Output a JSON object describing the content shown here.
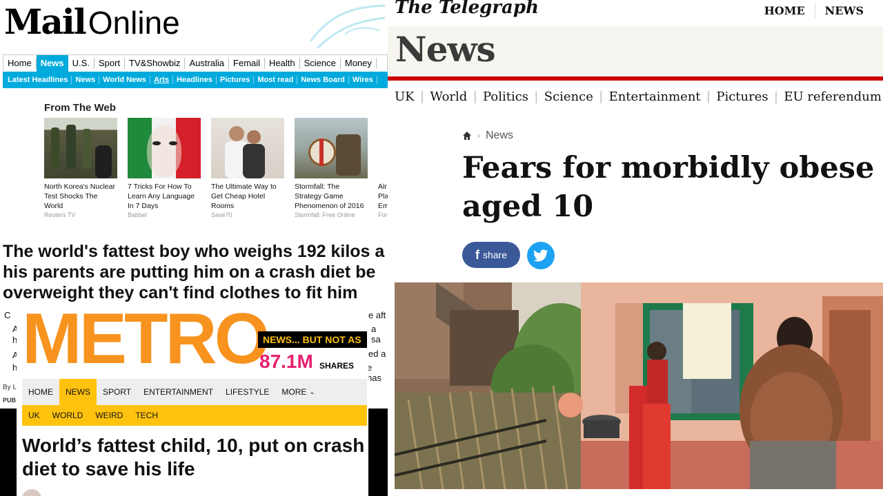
{
  "mail": {
    "logo_bold": "Mail",
    "logo_light": "Online",
    "nav": [
      "Home",
      "News",
      "U.S.",
      "Sport",
      "TV&Showbiz",
      "Australia",
      "Femail",
      "Health",
      "Science",
      "Money"
    ],
    "subnav": [
      "Latest Headlines",
      "News",
      "World News",
      "Arts",
      "Headlines",
      "Pictures",
      "Most read",
      "News Board",
      "Wires"
    ],
    "from_the_web": "From The Web",
    "cards": [
      {
        "title": "North Korea's Nuclear Test Shocks The World",
        "source": "Reuters TV"
      },
      {
        "title": "7 Tricks For How To Learn Any Language In 7 Days",
        "source": "Babbel"
      },
      {
        "title": "The Ultimate Way to Get Cheap Hotel Rooms",
        "source": "Save70"
      },
      {
        "title": "Stormfall: The Strategy Game Phenomenon of 2016",
        "source": "Stormfall: Free Online"
      },
      {
        "title": "Alr Pla Em",
        "source": "For"
      }
    ],
    "headline_lines": [
      "The world's fattest boy who weighs 192 kilos a",
      "his parents are putting him on a crash diet be",
      "overweight they can't find clothes to fit him"
    ],
    "fragments": [
      "C",
      "A",
      "h",
      "A",
      "h",
      "e aft",
      "a sa",
      "ed a",
      "e has",
      "By L",
      "PUB"
    ]
  },
  "metro": {
    "logo": "METRO",
    "tagline": "NEWS... BUT NOT AS",
    "shares_value": "87.1M",
    "shares_label": "SHARES",
    "nav": [
      "HOME",
      "NEWS",
      "SPORT",
      "ENTERTAINMENT",
      "LIFESTYLE",
      "MORE"
    ],
    "subnav": [
      "UK",
      "WORLD",
      "WEIRD",
      "TECH"
    ],
    "title": "World’s fattest child, 10, put on crash diet to save his life"
  },
  "telegraph": {
    "brand": "The Telegraph",
    "topnav": [
      "HOME",
      "NEWS"
    ],
    "section": "News",
    "subnav": [
      "UK",
      "World",
      "Politics",
      "Science",
      "Entertainment",
      "Pictures",
      "EU referendum"
    ],
    "breadcrumb": "News",
    "title_lines": [
      "Fears for morbidly obese bo",
      "aged 10"
    ],
    "share_label": "share"
  },
  "colors": {
    "mail_blue": "#00aadd",
    "metro_orange": "#f7931e",
    "metro_yellow": "#ffc20e",
    "metro_pink": "#e8206f",
    "telegraph_red": "#cc0000",
    "facebook": "#3b5998",
    "twitter": "#1da1f2"
  }
}
